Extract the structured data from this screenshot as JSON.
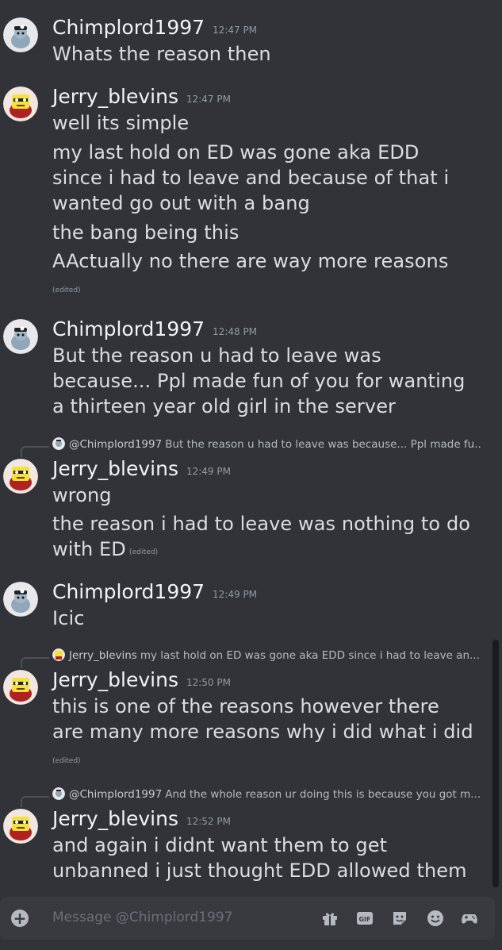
{
  "messages": [
    {
      "author": "Chimplord1997",
      "time": "12:47 PM",
      "avatar": "chimplord-avatar",
      "lines": [
        "Whats the reason then"
      ]
    },
    {
      "author": "Jerry_blevins",
      "time": "12:47 PM",
      "avatar": "jerry-avatar",
      "lines": [
        "well its simple",
        "my last hold on ED was gone aka EDD",
        "since i had to leave and because of that i",
        "wanted go out with a bang",
        "the bang being this",
        "AActually no there are way more reasons"
      ],
      "edited": "(edited)"
    },
    {
      "author": "Chimplord1997",
      "time": "12:48 PM",
      "avatar": "chimplord-avatar",
      "lines": [
        "But the reason u had to leave was",
        "because... Ppl made fun of you for wanting",
        "a thirteen year old girl in the server"
      ]
    },
    {
      "reply": {
        "name": "@Chimplord1997",
        "text": "But the reason u had to leave was because... Ppl made fu..."
      },
      "author": "Jerry_blevins",
      "time": "12:49 PM",
      "avatar": "jerry-avatar",
      "lines": [
        "wrong",
        "the reason i had to leave was nothing to do",
        "with ED"
      ],
      "edited": "(edited)"
    },
    {
      "author": "Chimplord1997",
      "time": "12:49 PM",
      "avatar": "chimplord-avatar",
      "lines": [
        "Icic"
      ]
    },
    {
      "reply": {
        "name": "Jerry_blevins",
        "text": "my last hold on ED was gone aka EDD since i had to leave an..."
      },
      "author": "Jerry_blevins",
      "time": "12:50 PM",
      "avatar": "jerry-avatar",
      "lines": [
        "this is one of the reasons however there",
        "are many more reasons why i did what i did"
      ],
      "edited": "(edited)"
    },
    {
      "reply": {
        "name": "@Chimplord1997",
        "text": "And the whole reason ur doing this is because you got m..."
      },
      "author": "Jerry_blevins",
      "time": "12:52 PM",
      "avatar": "jerry-avatar",
      "lines": [
        "and again i didnt want them to get",
        "unbanned i just thought EDD allowed them"
      ]
    }
  ],
  "composer": {
    "placeholder": "Message @Chimplord1997",
    "tools": [
      "gift-icon",
      "gif-icon",
      "sticker-icon",
      "emoji-icon",
      "activity-icon"
    ],
    "gif_label": "GIF"
  },
  "colors": {
    "background": "#313338",
    "text": "#dbdee1",
    "username": "#f2f3f5",
    "timestamp": "#949ba4",
    "composer": "#383a40"
  }
}
